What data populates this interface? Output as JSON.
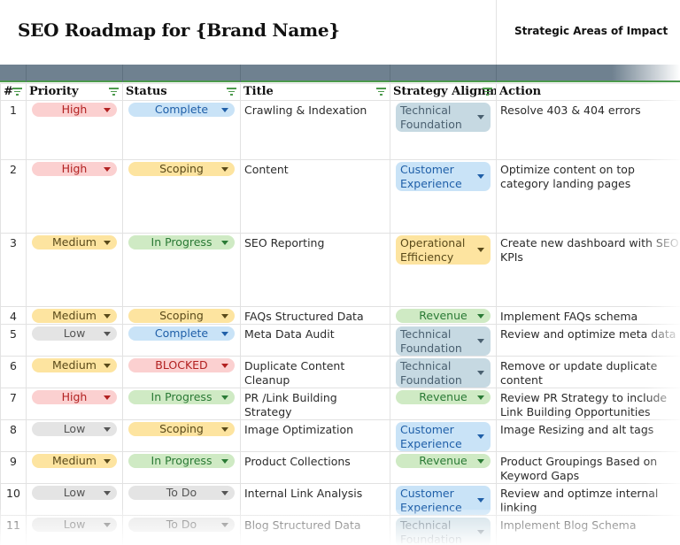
{
  "page": {
    "title": "SEO Roadmap for {Brand Name}",
    "side_title": "Strategic Areas of Impact"
  },
  "table": {
    "columns": [
      {
        "label": "#",
        "filter": true
      },
      {
        "label": "Priority",
        "filter": true
      },
      {
        "label": "Status",
        "filter": true
      },
      {
        "label": "Title",
        "filter": true
      },
      {
        "label": "Strategy Alignm",
        "filter": true
      },
      {
        "label": "Action",
        "filter": false
      }
    ],
    "rows": [
      {
        "num": "1",
        "priority": "High",
        "status": "Complete",
        "title": "Crawling & Indexation",
        "strategy": "Technical Foundation",
        "action": "Resolve 403 & 404 errors"
      },
      {
        "num": "2",
        "priority": "High",
        "status": "Scoping",
        "title": "Content",
        "strategy": "Customer Experience",
        "action": "Optimize content on top category landing pages"
      },
      {
        "num": "3",
        "priority": "Medium",
        "status": "In Progress",
        "title": "SEO Reporting",
        "strategy": "Operational Efficiency",
        "action": "Create new dashboard with SEO KPIs"
      },
      {
        "num": "4",
        "priority": "Medium",
        "status": "Scoping",
        "title": "FAQs Structured Data",
        "strategy": "Revenue",
        "action": "Implement FAQs schema"
      },
      {
        "num": "5",
        "priority": "Low",
        "status": "Complete",
        "title": "Meta Data Audit",
        "strategy": "Technical Foundation",
        "action": "Review and optimize meta data"
      },
      {
        "num": "6",
        "priority": "Medium",
        "status": "BLOCKED",
        "title": "Duplicate Content Cleanup",
        "strategy": "Technical Foundation",
        "action": "Remove or update duplicate content"
      },
      {
        "num": "7",
        "priority": "High",
        "status": "In Progress",
        "title": "PR /Link Building Strategy",
        "strategy": "Revenue",
        "action": "Review PR Strategy to include Link Building Opportunities"
      },
      {
        "num": "8",
        "priority": "Low",
        "status": "Scoping",
        "title": "Image Optimization",
        "strategy": "Customer Experience",
        "action": "Image Resizing and alt tags"
      },
      {
        "num": "9",
        "priority": "Medium",
        "status": "In Progress",
        "title": "Product Collections",
        "strategy": "Revenue",
        "action": "Product Groupings Based on Keyword Gaps"
      },
      {
        "num": "10",
        "priority": "Low",
        "status": "To Do",
        "title": "Internal Link Analysis",
        "strategy": "Customer Experience",
        "action": "Review and optimze internal linking"
      },
      {
        "num": "11",
        "priority": "Low",
        "status": "To Do",
        "title": "Blog Structured Data",
        "strategy": "Technical Foundation",
        "action": "Implement Blog Schema"
      }
    ]
  },
  "colors": {
    "header_band": "#6f8190",
    "accent_green": "#4d9a4d",
    "priority": {
      "High": "red",
      "Medium": "yellow",
      "Low": "gray"
    },
    "status": {
      "Complete": "blue",
      "Scoping": "yellow",
      "In Progress": "green",
      "BLOCKED": "red",
      "To Do": "gray"
    },
    "strategy": {
      "Technical Foundation": "teal",
      "Customer Experience": "blue",
      "Operational Efficiency": "yellow",
      "Revenue": "green"
    }
  }
}
